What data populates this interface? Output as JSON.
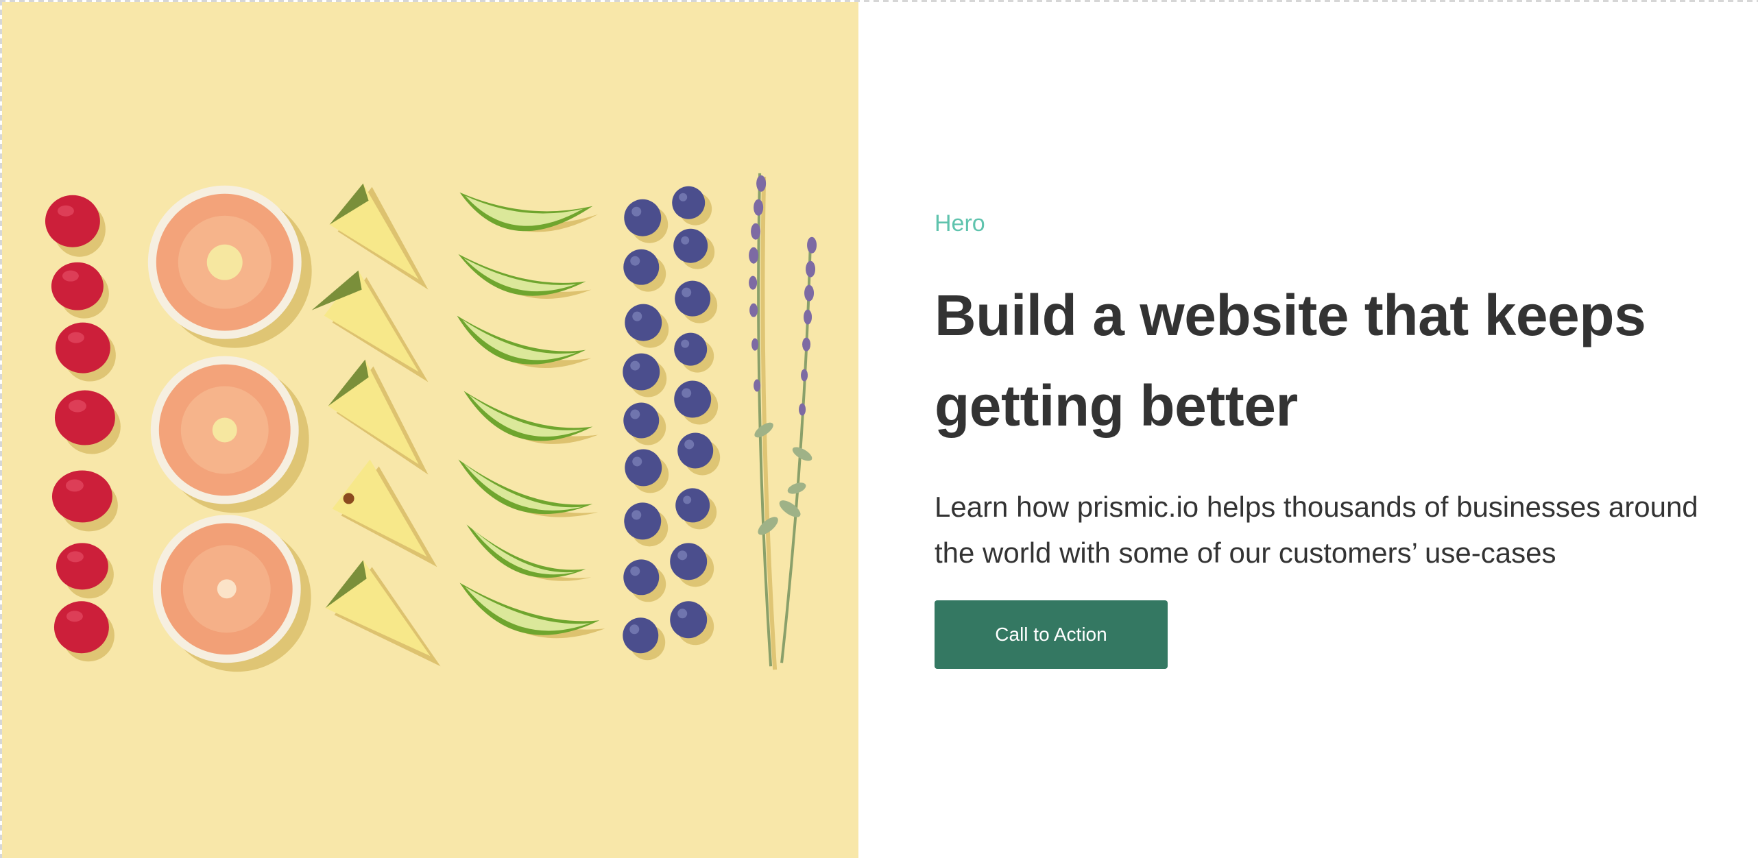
{
  "hero": {
    "eyebrow": "Hero",
    "title": "Build a website that keeps getting better",
    "description": "Learn how prismic.io helps thousands of businesses around the world with some of our customers’ use-cases",
    "cta_label": "Call to Action"
  },
  "image": {
    "background_color": "#f8e7a9",
    "columns": [
      "raspberries",
      "grapefruit-slices",
      "pineapple-wedges",
      "lime-wedges",
      "blueberries",
      "lavender-sprigs"
    ]
  },
  "colors": {
    "eyebrow": "#5fc3ad",
    "text": "#333333",
    "button": "#347862"
  }
}
